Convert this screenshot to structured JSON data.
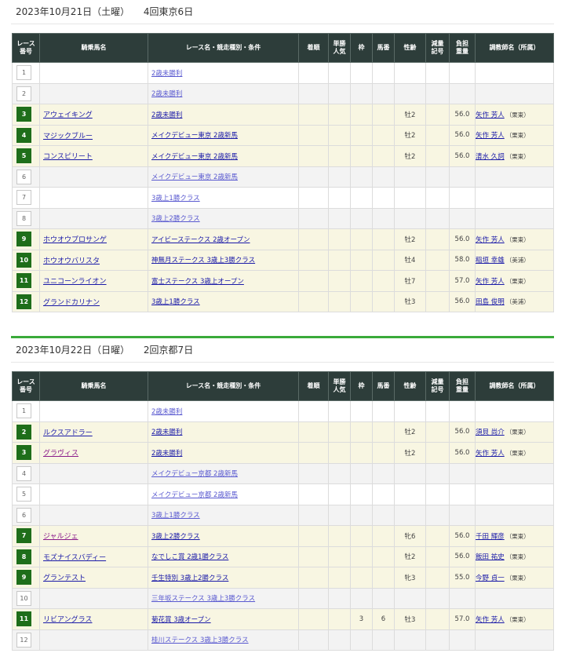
{
  "headers": [
    "レース番号",
    "騎乗馬名",
    "レース名・競走種別・条件",
    "着順",
    "単勝人気",
    "枠",
    "馬番",
    "性齢",
    "減量記号",
    "負担重量",
    "調教師名（所属）"
  ],
  "header_lines": [
    [
      "レース",
      "番号"
    ],
    [
      "騎乗馬名"
    ],
    [
      "レース名・競走種別・条件"
    ],
    [
      "着順"
    ],
    [
      "単勝",
      "人気"
    ],
    [
      "枠"
    ],
    [
      "馬番"
    ],
    [
      "性齢"
    ],
    [
      "減量",
      "記号"
    ],
    [
      "負担",
      "重量"
    ],
    [
      "調教師名（所属）"
    ]
  ],
  "days": [
    {
      "date": "2023年10月21日（土曜）",
      "meeting": "4回東京6日",
      "rows": [
        {
          "no": "1",
          "horse": "",
          "race": "2歳未勝利",
          "rank": "",
          "pop": "",
          "frame": "",
          "num": "",
          "age": "",
          "reduce": "",
          "weight": "",
          "trainer": "",
          "loc": ""
        },
        {
          "no": "2",
          "horse": "",
          "race": "2歳未勝利",
          "rank": "",
          "pop": "",
          "frame": "",
          "num": "",
          "age": "",
          "reduce": "",
          "weight": "",
          "trainer": "",
          "loc": ""
        },
        {
          "no": "3",
          "horse": "アウェイキング",
          "race": "2歳未勝利",
          "rank": "",
          "pop": "",
          "frame": "",
          "num": "",
          "age": "牡2",
          "reduce": "",
          "weight": "56.0",
          "trainer": "矢作 芳人",
          "loc": "（栗東）"
        },
        {
          "no": "4",
          "horse": "マジックブルー",
          "race": "メイクデビュー東京 2歳新馬",
          "rank": "",
          "pop": "",
          "frame": "",
          "num": "",
          "age": "牡2",
          "reduce": "",
          "weight": "56.0",
          "trainer": "矢作 芳人",
          "loc": "（栗東）"
        },
        {
          "no": "5",
          "horse": "コンスピリート",
          "race": "メイクデビュー東京 2歳新馬",
          "rank": "",
          "pop": "",
          "frame": "",
          "num": "",
          "age": "牡2",
          "reduce": "",
          "weight": "56.0",
          "trainer": "清水 久詞",
          "loc": "（栗東）"
        },
        {
          "no": "6",
          "horse": "",
          "race": "メイクデビュー東京 2歳新馬",
          "rank": "",
          "pop": "",
          "frame": "",
          "num": "",
          "age": "",
          "reduce": "",
          "weight": "",
          "trainer": "",
          "loc": ""
        },
        {
          "no": "7",
          "horse": "",
          "race": "3歳上1勝クラス",
          "rank": "",
          "pop": "",
          "frame": "",
          "num": "",
          "age": "",
          "reduce": "",
          "weight": "",
          "trainer": "",
          "loc": ""
        },
        {
          "no": "8",
          "horse": "",
          "race": "3歳上2勝クラス",
          "rank": "",
          "pop": "",
          "frame": "",
          "num": "",
          "age": "",
          "reduce": "",
          "weight": "",
          "trainer": "",
          "loc": ""
        },
        {
          "no": "9",
          "horse": "ホウオウプロサンゲ",
          "race": "アイビーステークス 2歳オープン",
          "rank": "",
          "pop": "",
          "frame": "",
          "num": "",
          "age": "牡2",
          "reduce": "",
          "weight": "56.0",
          "trainer": "矢作 芳人",
          "loc": "（栗東）"
        },
        {
          "no": "10",
          "horse": "ホウオウバリスタ",
          "race": "神無月ステークス 3歳上3勝クラス",
          "rank": "",
          "pop": "",
          "frame": "",
          "num": "",
          "age": "牡4",
          "reduce": "",
          "weight": "58.0",
          "trainer": "稲垣 幸雄",
          "loc": "（美浦）"
        },
        {
          "no": "11",
          "horse": "ユニコーンライオン",
          "race": "富士ステークス 3歳上オープン",
          "rank": "",
          "pop": "",
          "frame": "",
          "num": "",
          "age": "牡7",
          "reduce": "",
          "weight": "57.0",
          "trainer": "矢作 芳人",
          "loc": "（栗東）"
        },
        {
          "no": "12",
          "horse": "グランドカリナン",
          "race": "3歳上1勝クラス",
          "rank": "",
          "pop": "",
          "frame": "",
          "num": "",
          "age": "牡3",
          "reduce": "",
          "weight": "56.0",
          "trainer": "田島 俊明",
          "loc": "（美浦）"
        }
      ]
    },
    {
      "date": "2023年10月22日（日曜）",
      "meeting": "2回京都7日",
      "rows": [
        {
          "no": "1",
          "horse": "",
          "race": "2歳未勝利",
          "rank": "",
          "pop": "",
          "frame": "",
          "num": "",
          "age": "",
          "reduce": "",
          "weight": "",
          "trainer": "",
          "loc": ""
        },
        {
          "no": "2",
          "horse": "ルクスアドラー",
          "race": "2歳未勝利",
          "rank": "",
          "pop": "",
          "frame": "",
          "num": "",
          "age": "牡2",
          "reduce": "",
          "weight": "56.0",
          "trainer": "須貝 尚介",
          "loc": "（栗東）"
        },
        {
          "no": "3",
          "horse": "グラヴィス",
          "race": "2歳未勝利",
          "rank": "",
          "pop": "",
          "frame": "",
          "num": "",
          "age": "牡2",
          "reduce": "",
          "weight": "56.0",
          "trainer": "矢作 芳人",
          "loc": "（栗東）",
          "visited": true
        },
        {
          "no": "4",
          "horse": "",
          "race": "メイクデビュー京都 2歳新馬",
          "rank": "",
          "pop": "",
          "frame": "",
          "num": "",
          "age": "",
          "reduce": "",
          "weight": "",
          "trainer": "",
          "loc": ""
        },
        {
          "no": "5",
          "horse": "",
          "race": "メイクデビュー京都 2歳新馬",
          "rank": "",
          "pop": "",
          "frame": "",
          "num": "",
          "age": "",
          "reduce": "",
          "weight": "",
          "trainer": "",
          "loc": ""
        },
        {
          "no": "6",
          "horse": "",
          "race": "3歳上1勝クラス",
          "rank": "",
          "pop": "",
          "frame": "",
          "num": "",
          "age": "",
          "reduce": "",
          "weight": "",
          "trainer": "",
          "loc": ""
        },
        {
          "no": "7",
          "horse": "ジャルジェ",
          "race": "3歳上2勝クラス",
          "rank": "",
          "pop": "",
          "frame": "",
          "num": "",
          "age": "牝6",
          "reduce": "",
          "weight": "56.0",
          "trainer": "千田 輝彦",
          "loc": "（栗東）",
          "visited": true
        },
        {
          "no": "8",
          "horse": "モズナイスバディー",
          "race": "なでしこ賞 2歳1勝クラス",
          "rank": "",
          "pop": "",
          "frame": "",
          "num": "",
          "age": "牡2",
          "reduce": "",
          "weight": "56.0",
          "trainer": "飯田 祐史",
          "loc": "（栗東）"
        },
        {
          "no": "9",
          "horse": "グランテスト",
          "race": "壬生特別 3歳上2勝クラス",
          "rank": "",
          "pop": "",
          "frame": "",
          "num": "",
          "age": "牝3",
          "reduce": "",
          "weight": "55.0",
          "trainer": "今野 貞一",
          "loc": "（栗東）"
        },
        {
          "no": "10",
          "horse": "",
          "race": "三年坂ステークス 3歳上3勝クラス",
          "rank": "",
          "pop": "",
          "frame": "",
          "num": "",
          "age": "",
          "reduce": "",
          "weight": "",
          "trainer": "",
          "loc": ""
        },
        {
          "no": "11",
          "horse": "リビアングラス",
          "race": "菊花賞 3歳オープン",
          "rank": "",
          "pop": "",
          "frame": "3",
          "num": "6",
          "age": "牡3",
          "reduce": "",
          "weight": "57.0",
          "trainer": "矢作 芳人",
          "loc": "（栗東）"
        },
        {
          "no": "12",
          "horse": "",
          "race": "桂川ステークス 3歳上3勝クラス",
          "rank": "",
          "pop": "",
          "frame": "",
          "num": "",
          "age": "",
          "reduce": "",
          "weight": "",
          "trainer": "",
          "loc": ""
        }
      ]
    }
  ]
}
